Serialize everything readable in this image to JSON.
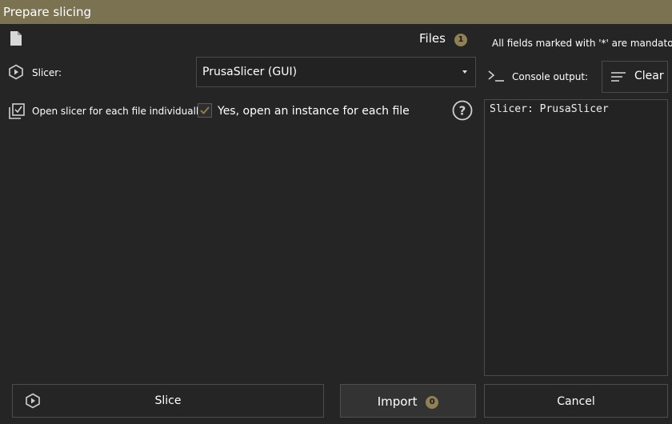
{
  "window": {
    "title": "Prepare slicing"
  },
  "files": {
    "label": "Files",
    "count": "1"
  },
  "mandatory_note": "All fields marked with '*' are mandatory.",
  "slicer": {
    "label": "Slicer:",
    "selected": "PrusaSlicer (GUI)"
  },
  "open_each": {
    "label": "Open slicer for each file individually?",
    "checkbox_label": "Yes, open an instance for each file",
    "checked": true
  },
  "console": {
    "label": "Console output:",
    "clear_label": "Clear",
    "text": "Slicer: PrusaSlicer"
  },
  "footer": {
    "slice_label": "Slice",
    "import_label": "Import",
    "import_count": "0",
    "cancel_label": "Cancel"
  },
  "colors": {
    "accent": "#8f8154",
    "titlebar": "#7b7252",
    "background": "#252525"
  }
}
